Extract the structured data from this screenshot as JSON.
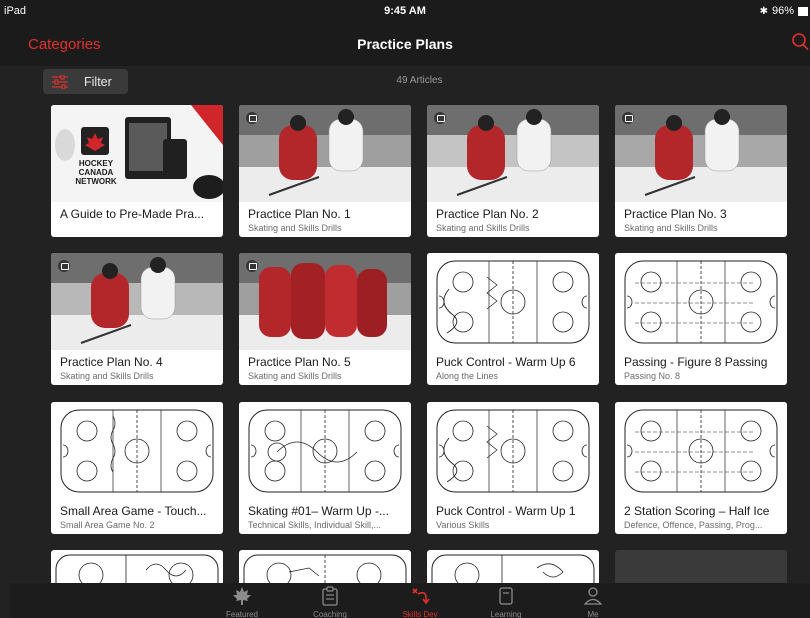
{
  "status": {
    "device": "iPad",
    "time": "9:45 AM",
    "battery": "96%"
  },
  "nav": {
    "left_label": "Categories",
    "title": "Practice Plans",
    "search_icon": "search-icon"
  },
  "toolbar": {
    "filter_label": "Filter",
    "article_count": "49 Articles"
  },
  "colors": {
    "accent": "#e0312d",
    "background": "#222222",
    "card": "#ffffff"
  },
  "cards": [
    {
      "title": "A Guide to Pre-Made Pra...",
      "subtitle": "",
      "thumb": "hc-network",
      "brand": "HOCKEY CANADA NETWORK"
    },
    {
      "title": "Practice Plan No. 1",
      "subtitle": "Skating and Skills Drills",
      "thumb": "photo-player"
    },
    {
      "title": "Practice Plan No. 2",
      "subtitle": "Skating and Skills Drills",
      "thumb": "photo-player"
    },
    {
      "title": "Practice Plan No. 3",
      "subtitle": "Skating and Skills Drills",
      "thumb": "photo-player"
    },
    {
      "title": "Practice Plan No. 4",
      "subtitle": "Skating and Skills Drills",
      "thumb": "photo-player"
    },
    {
      "title": "Practice Plan No. 5",
      "subtitle": "Skating and Skills Drills",
      "thumb": "photo-team"
    },
    {
      "title": "Puck Control - Warm Up 6",
      "subtitle": "Along the Lines",
      "thumb": "rink-diagram"
    },
    {
      "title": "Passing - Figure 8 Passing",
      "subtitle": "Passing No. 8",
      "thumb": "rink-diagram"
    },
    {
      "title": "Small Area Game - Touch...",
      "subtitle": "Small Area Game No. 2",
      "thumb": "rink-diagram"
    },
    {
      "title": "Skating #01– Warm Up -...",
      "subtitle": "Technical Skills, Individual Skill,...",
      "thumb": "rink-diagram"
    },
    {
      "title": "Puck Control - Warm Up 1",
      "subtitle": "Various Skills",
      "thumb": "rink-diagram"
    },
    {
      "title": "2 Station Scoring – Half Ice",
      "subtitle": "Defence, Offence, Passing, Prog...",
      "thumb": "rink-diagram"
    }
  ],
  "tabs": [
    {
      "label": "Featured",
      "icon": "maple-leaf-icon",
      "active": false
    },
    {
      "label": "Coaching",
      "icon": "clipboard-icon",
      "active": false
    },
    {
      "label": "Skills Dev",
      "icon": "play-diagram-icon",
      "active": true
    },
    {
      "label": "Learning",
      "icon": "tablet-icon",
      "active": false
    },
    {
      "label": "Me",
      "icon": "person-icon",
      "active": false
    }
  ]
}
